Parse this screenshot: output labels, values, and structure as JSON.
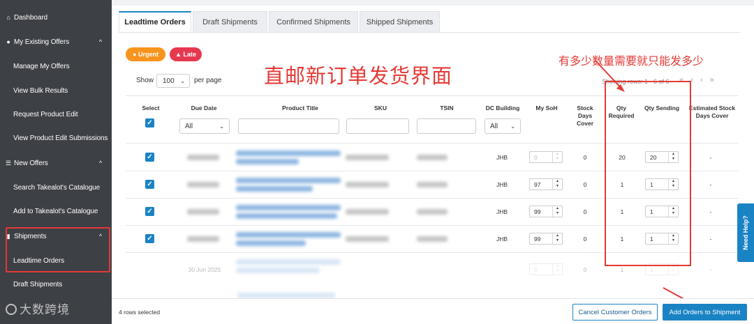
{
  "sidebar": {
    "items": [
      {
        "label": "Dashboard",
        "icon": "home-icon",
        "section": true
      },
      {
        "label": "My Existing Offers",
        "icon": "tag-icon",
        "section": true,
        "chevron": "^"
      },
      {
        "label": "Manage My Offers"
      },
      {
        "label": "View Bulk Results"
      },
      {
        "label": "Request Product Edit"
      },
      {
        "label": "View Product Edit Submissions"
      },
      {
        "label": "New Offers",
        "icon": "list-icon",
        "section": true,
        "chevron": "^"
      },
      {
        "label": "Search Takealot's Catalogue"
      },
      {
        "label": "Add to Takealot's Catalogue"
      },
      {
        "label": "Shipments",
        "icon": "truck-icon",
        "section": true,
        "chevron": "^"
      },
      {
        "label": "Leadtime Orders"
      },
      {
        "label": "Draft Shipments"
      }
    ],
    "watermark": "大数跨境"
  },
  "tabs": [
    "Leadtime Orders",
    "Draft Shipments",
    "Confirmed Shipments",
    "Shipped Shipments"
  ],
  "badges": {
    "urgent": "Urgent",
    "late": "Late"
  },
  "paging": {
    "show": "Show",
    "per_page_value": "100",
    "per_page": "per page",
    "showing": "Showing rows: 1 - 6 of 6"
  },
  "annotations": {
    "title": "直邮新订单发货界面",
    "qty_note": "有多少数量需要就只能发多少"
  },
  "table": {
    "headers": [
      "Select",
      "Due Date",
      "Product Title",
      "SKU",
      "TSIN",
      "DC Building",
      "My SoH",
      "Stock Days Cover",
      "Qty Required",
      "Qty Sending",
      "Estimated Stock Days Cover"
    ],
    "filters": {
      "due_date": "All",
      "dc_building": "All"
    },
    "rows": [
      {
        "dc": "JHB",
        "soh": "0",
        "stock_days": "0",
        "qty_required": "20",
        "qty_sending": "20",
        "est": "-"
      },
      {
        "dc": "JHB",
        "soh": "97",
        "stock_days": "0",
        "qty_required": "1",
        "qty_sending": "1",
        "est": "-"
      },
      {
        "dc": "JHB",
        "soh": "99",
        "stock_days": "0",
        "qty_required": "1",
        "qty_sending": "1",
        "est": "-"
      },
      {
        "dc": "JHB",
        "soh": "99",
        "stock_days": "0",
        "qty_required": "1",
        "qty_sending": "1",
        "est": "-"
      },
      {
        "due_date": "30 Jun 2025",
        "soh": "0",
        "stock_days": "0",
        "qty_required": "1",
        "qty_sending": "1",
        "est": "-"
      }
    ]
  },
  "footer": {
    "selected": "4 rows selected",
    "cancel": "Cancel Customer Orders",
    "add": "Add Orders to Shipment"
  },
  "help": "Need Help?"
}
